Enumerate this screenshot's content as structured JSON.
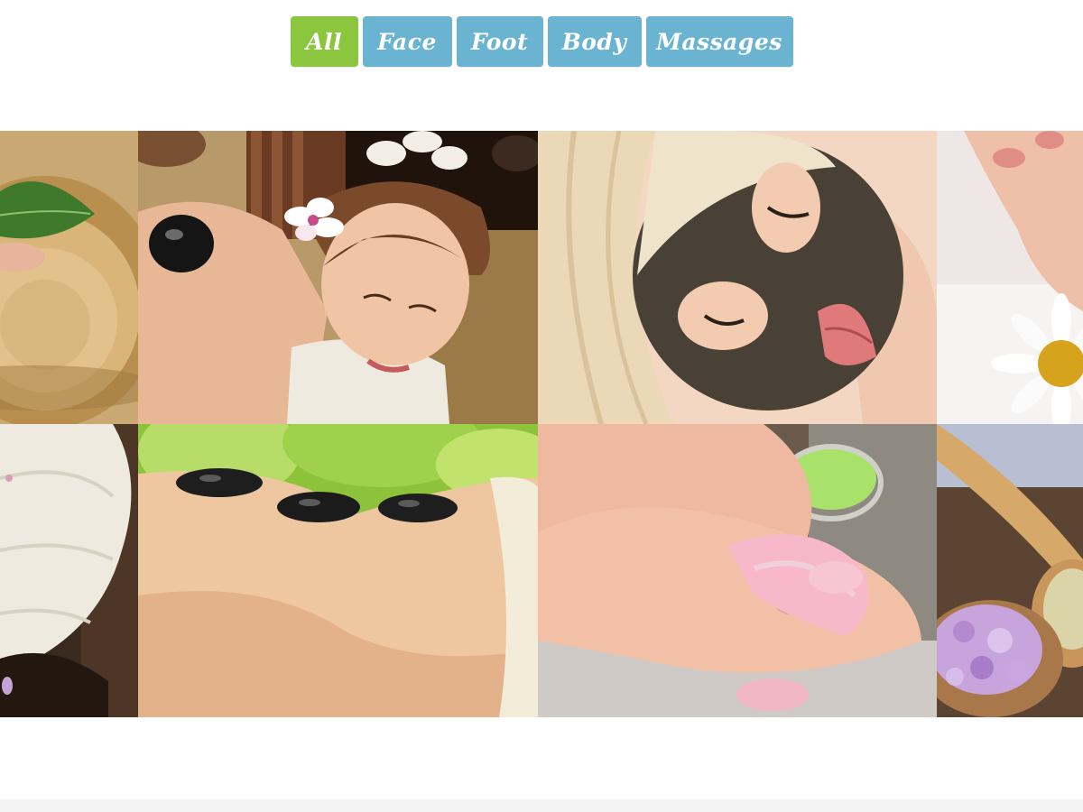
{
  "filters": [
    {
      "label": "All",
      "active": true,
      "color": "#8cc63f"
    },
    {
      "label": "Face",
      "active": false,
      "color": "#6ab4d2"
    },
    {
      "label": "Foot",
      "active": false,
      "color": "#6ab4d2"
    },
    {
      "label": "Body",
      "active": false,
      "color": "#6ab4d2"
    },
    {
      "label": "Massages",
      "active": false,
      "color": "#6ab4d2"
    }
  ],
  "gallery": {
    "items": [
      {
        "subject": "wooden bowl with green leaf"
      },
      {
        "subject": "woman with hot stones and orchid"
      },
      {
        "subject": "woman with dark facial mask"
      },
      {
        "subject": "hands with white daisy"
      },
      {
        "subject": "rolled white towel"
      },
      {
        "subject": "back with black massage stones"
      },
      {
        "subject": "hands holding pink petals"
      },
      {
        "subject": "wooden spoon with purple bath salt"
      }
    ]
  },
  "colors": {
    "active_filter": "#8cc63f",
    "inactive_filter": "#6ab4d2"
  }
}
